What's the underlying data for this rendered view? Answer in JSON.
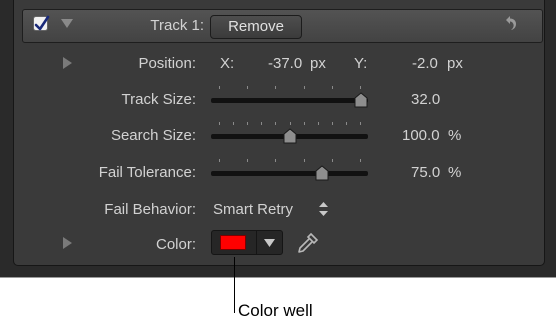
{
  "header": {
    "enabled": true,
    "track_label": "Track 1:",
    "remove_label": "Remove"
  },
  "position": {
    "label": "Position:",
    "x_label": "X:",
    "x_value": "-37.0",
    "x_unit": "px",
    "y_label": "Y:",
    "y_value": "-2.0",
    "y_unit": "px"
  },
  "track_size": {
    "label": "Track Size:",
    "value_text": "32.0",
    "level": 1.0
  },
  "search_size": {
    "label": "Search Size:",
    "value_text": "100.0",
    "unit": "%",
    "level": 0.5
  },
  "fail_tolerance": {
    "label": "Fail Tolerance:",
    "value_text": "75.0",
    "unit": "%",
    "level": 0.73
  },
  "fail_behavior": {
    "label": "Fail Behavior:",
    "value": "Smart Retry"
  },
  "color": {
    "label": "Color:",
    "swatch_color": "#ff0000"
  },
  "callout": {
    "text": "Color well"
  },
  "icons": [
    "checkmark-icon",
    "disclosure-triangle-icon",
    "reset-arrow-icon",
    "slider-knob-icon",
    "popup-arrows-icon",
    "dropdown-arrow-icon",
    "eyedropper-icon"
  ]
}
